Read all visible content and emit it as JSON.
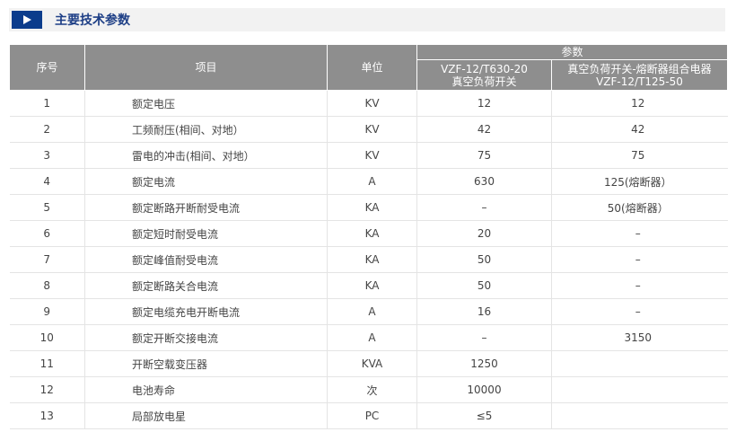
{
  "section": {
    "title": "主要技术参数",
    "icon": "play-icon"
  },
  "table": {
    "headers": {
      "no": "序号",
      "item": "项目",
      "unit": "单位",
      "params": "参数",
      "col_a_line1": "VZF-12/T630-20",
      "col_a_line2": "真空负荷开关",
      "col_b_line1": "真空负荷开关-熔断器组合电器",
      "col_b_line2": "VZF-12/T125-50"
    },
    "rows": [
      {
        "no": "1",
        "item": "额定电压",
        "unit": "KV",
        "a": "12",
        "b": "12"
      },
      {
        "no": "2",
        "item": "工频耐压(相间、对地）",
        "unit": "KV",
        "a": "42",
        "b": "42"
      },
      {
        "no": "3",
        "item": "雷电的冲击(相间、对地）",
        "unit": "KV",
        "a": "75",
        "b": "75"
      },
      {
        "no": "4",
        "item": "额定电流",
        "unit": "A",
        "a": "630",
        "b": "125(熔断器）"
      },
      {
        "no": "5",
        "item": "额定断路开断耐受电流",
        "unit": "KA",
        "a": "–",
        "b": "50(熔断器）"
      },
      {
        "no": "6",
        "item": "额定短时耐受电流",
        "unit": "KA",
        "a": "20",
        "b": "–"
      },
      {
        "no": "7",
        "item": "额定峰值耐受电流",
        "unit": "KA",
        "a": "50",
        "b": "–"
      },
      {
        "no": "8",
        "item": "额定断路关合电流",
        "unit": "KA",
        "a": "50",
        "b": "–"
      },
      {
        "no": "9",
        "item": "额定电缆充电开断电流",
        "unit": "A",
        "a": "16",
        "b": "–"
      },
      {
        "no": "10",
        "item": "额定开断交接电流",
        "unit": "A",
        "a": "–",
        "b": "3150"
      },
      {
        "no": "11",
        "item": "开断空载变压器",
        "unit": "KVA",
        "a": "1250",
        "b": ""
      },
      {
        "no": "12",
        "item": "电池寿命",
        "unit": "次",
        "a": "10000",
        "b": ""
      },
      {
        "no": "13",
        "item": "局部放电星",
        "unit": "PC",
        "a": "≤5",
        "b": ""
      }
    ]
  }
}
